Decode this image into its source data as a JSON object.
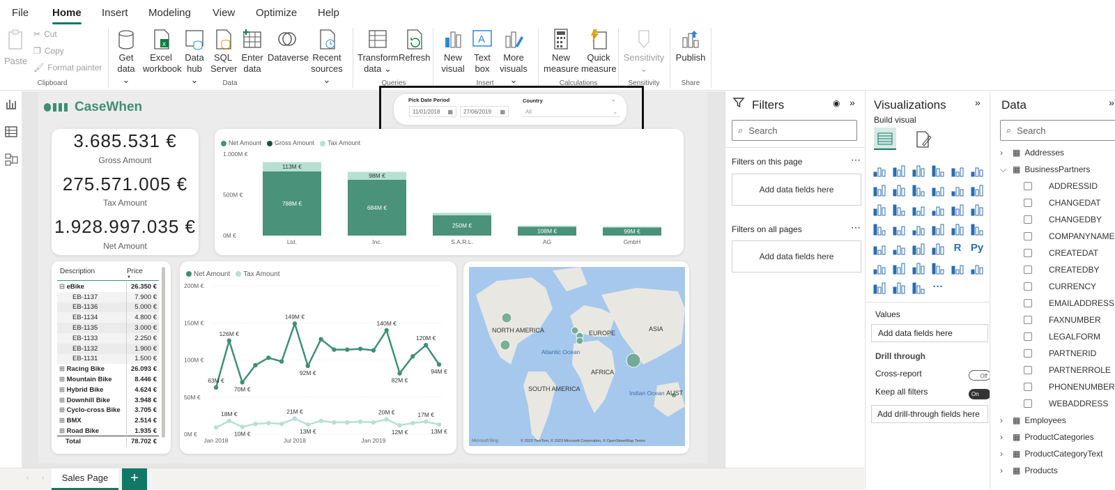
{
  "menu": {
    "tabs": [
      "File",
      "Home",
      "Insert",
      "Modeling",
      "View",
      "Optimize",
      "Help"
    ],
    "active": "Home"
  },
  "ribbon": {
    "clipboard": {
      "paste": "Paste",
      "cut": "Cut",
      "copy": "Copy",
      "format_painter": "Format painter",
      "group": "Clipboard"
    },
    "data": {
      "get_data_1": "Get",
      "get_data_2": "data",
      "excel_1": "Excel",
      "excel_2": "workbook",
      "hub_1": "Data",
      "hub_2": "hub",
      "sql_1": "SQL",
      "sql_2": "Server",
      "enter_1": "Enter",
      "enter_2": "data",
      "dataverse": "Dataverse",
      "recent_1": "Recent",
      "recent_2": "sources",
      "group": "Data"
    },
    "queries": {
      "transform_1": "Transform",
      "transform_2": "data",
      "refresh": "Refresh",
      "group": "Queries"
    },
    "insert": {
      "visual_1": "New",
      "visual_2": "visual",
      "text_1": "Text",
      "text_2": "box",
      "more_1": "More",
      "more_2": "visuals",
      "group": "Insert"
    },
    "calc": {
      "measure_1": "New",
      "measure_2": "measure",
      "quick_1": "Quick",
      "quick_2": "measure",
      "group": "Calculations"
    },
    "sensitivity": {
      "label": "Sensitivity",
      "group": "Sensitivity"
    },
    "share": {
      "publish": "Publish",
      "group": "Share"
    }
  },
  "report": {
    "logo": "CaseWhen",
    "slicer": {
      "title": "Pick Date Period",
      "from": "11/01/2018",
      "to": "27/06/2019",
      "country_label": "Country",
      "country_value": "All"
    },
    "kpis": [
      {
        "value": "3.685.531 €",
        "label": "Gross Amount"
      },
      {
        "value": "275.571.005 €",
        "label": "Tax Amount"
      },
      {
        "value": "1.928.997.035 €",
        "label": "Net Amount"
      }
    ],
    "table": {
      "headers": [
        "Description",
        "Price"
      ],
      "rows": [
        {
          "label": "eBike",
          "value": "26.350 €",
          "level": 0,
          "expanded": true
        },
        {
          "label": "EB-1137",
          "value": "7.900 €",
          "level": 1
        },
        {
          "label": "EB-1136",
          "value": "5.000 €",
          "level": 1
        },
        {
          "label": "EB-1134",
          "value": "4.800 €",
          "level": 1
        },
        {
          "label": "EB-1135",
          "value": "3.000 €",
          "level": 1
        },
        {
          "label": "EB-1133",
          "value": "2.250 €",
          "level": 1
        },
        {
          "label": "EB-1132",
          "value": "1.900 €",
          "level": 1
        },
        {
          "label": "EB-1131",
          "value": "1.500 €",
          "level": 1
        },
        {
          "label": "Racing Bike",
          "value": "26.093 €",
          "level": 0
        },
        {
          "label": "Mountain Bike",
          "value": "8.446 €",
          "level": 0
        },
        {
          "label": "Hybrid Bike",
          "value": "4.624 €",
          "level": 0
        },
        {
          "label": "Downhill Bike",
          "value": "3.948 €",
          "level": 0
        },
        {
          "label": "Cyclo-cross Bike",
          "value": "3.705 €",
          "level": 0
        },
        {
          "label": "BMX",
          "value": "2.514 €",
          "level": 0
        },
        {
          "label": "Road Bike",
          "value": "1.935 €",
          "level": 0
        }
      ],
      "total_label": "Total",
      "total_value": "78.702 €"
    },
    "map": {
      "labels": [
        "NORTH AMERICA",
        "EUROPE",
        "ASIA",
        "AFRICA",
        "SOUTH AMERICA",
        "Atlantic Ocean",
        "Indian Ocean",
        "AUST"
      ],
      "attribution": "Microsoft Bing",
      "copyright": "© 2023 TomTom, © 2023 Microsoft Corporation, © OpenStreetMap  Terms"
    }
  },
  "chart_data": [
    {
      "type": "bar",
      "stacked": true,
      "categories": [
        "Ltd.",
        "Inc.",
        "S.A.R.L.",
        "AG",
        "GmbH"
      ],
      "series": [
        {
          "name": "Net Amount",
          "values": [
            788,
            684,
            250,
            108,
            99
          ],
          "labels": [
            "788M €",
            "684M €",
            "250M €",
            "108M €",
            "99M €"
          ],
          "color": "#4a9279"
        },
        {
          "name": "Gross Amount",
          "values": [
            0,
            0,
            0,
            0,
            0
          ],
          "labels": [],
          "color": "#1f4e3d"
        },
        {
          "name": "Tax Amount",
          "values": [
            113,
            98,
            30,
            14,
            13
          ],
          "labels": [
            "113M €",
            "98M €",
            "",
            "",
            ""
          ],
          "color": "#b7e0d2"
        }
      ],
      "yticks": [
        "0M €",
        "500M €",
        "1.000M €"
      ],
      "ylim": [
        0,
        1000
      ]
    },
    {
      "type": "line",
      "x": [
        "Jan 2018",
        "Feb 2018",
        "Mar 2018",
        "Apr 2018",
        "May 2018",
        "Jun 2018",
        "Jul 2018",
        "Aug 2018",
        "Sep 2018",
        "Oct 2018",
        "Nov 2018",
        "Dec 2018",
        "Jan 2019",
        "Feb 2019",
        "Mar 2019",
        "Apr 2019",
        "May 2019",
        "Jun 2019"
      ],
      "xticks": [
        "Jan 2018",
        "Jul 2018",
        "Jan 2019"
      ],
      "series": [
        {
          "name": "Net Amount",
          "values": [
            63,
            126,
            70,
            93,
            103,
            98,
            149,
            92,
            128,
            114,
            114,
            115,
            113,
            140,
            82,
            105,
            120,
            94
          ],
          "color": "#3f8f72"
        },
        {
          "name": "Tax Amount",
          "values": [
            9,
            18,
            10,
            14,
            15,
            14,
            21,
            13,
            18,
            16,
            16,
            17,
            16,
            20,
            12,
            15,
            17,
            13
          ],
          "color": "#b7e0d2"
        }
      ],
      "data_labels": [
        {
          "i": 0,
          "s": 0,
          "t": "63M €"
        },
        {
          "i": 1,
          "s": 0,
          "t": "126M €"
        },
        {
          "i": 2,
          "s": 0,
          "t": "70M €"
        },
        {
          "i": 6,
          "s": 0,
          "t": "149M €"
        },
        {
          "i": 7,
          "s": 0,
          "t": "92M €"
        },
        {
          "i": 13,
          "s": 0,
          "t": "140M €"
        },
        {
          "i": 14,
          "s": 0,
          "t": "82M €"
        },
        {
          "i": 16,
          "s": 0,
          "t": "120M €"
        },
        {
          "i": 17,
          "s": 0,
          "t": "94M €"
        },
        {
          "i": 1,
          "s": 1,
          "t": "18M €"
        },
        {
          "i": 2,
          "s": 1,
          "t": "10M €"
        },
        {
          "i": 6,
          "s": 1,
          "t": "21M €"
        },
        {
          "i": 7,
          "s": 1,
          "t": "13M €"
        },
        {
          "i": 13,
          "s": 1,
          "t": "20M €"
        },
        {
          "i": 14,
          "s": 1,
          "t": "12M €"
        },
        {
          "i": 16,
          "s": 1,
          "t": "17M €"
        },
        {
          "i": 17,
          "s": 1,
          "t": "13M €"
        }
      ],
      "yticks": [
        "0M €",
        "50M €",
        "100M €",
        "150M €",
        "200M €"
      ],
      "ylim": [
        0,
        200
      ]
    }
  ],
  "filters": {
    "title": "Filters",
    "search": "Search",
    "on_page": "Filters on this page",
    "on_all": "Filters on all pages",
    "add": "Add data fields here"
  },
  "viz": {
    "title": "Visualizations",
    "build": "Build visual",
    "values": "Values",
    "add_values": "Add data fields here",
    "drill": "Drill through",
    "cross": "Cross-report",
    "cross_state": "Off",
    "keep": "Keep all filters",
    "keep_state": "On",
    "add_drill": "Add drill-through fields here"
  },
  "data": {
    "title": "Data",
    "search": "Search",
    "tables": [
      "Addresses",
      "BusinessPartners",
      "Employees",
      "ProductCategories",
      "ProductCategoryText",
      "Products"
    ],
    "fields": [
      "ADDRESSID",
      "CHANGEDAT",
      "CHANGEDBY",
      "COMPANYNAME",
      "CREATEDAT",
      "CREATEDBY",
      "CURRENCY",
      "EMAILADDRESS",
      "FAXNUMBER",
      "LEGALFORM",
      "PARTNERID",
      "PARTNERROLE",
      "PHONENUMBER",
      "WEBADDRESS"
    ]
  },
  "pages": {
    "tab": "Sales Page",
    "add": "+"
  }
}
